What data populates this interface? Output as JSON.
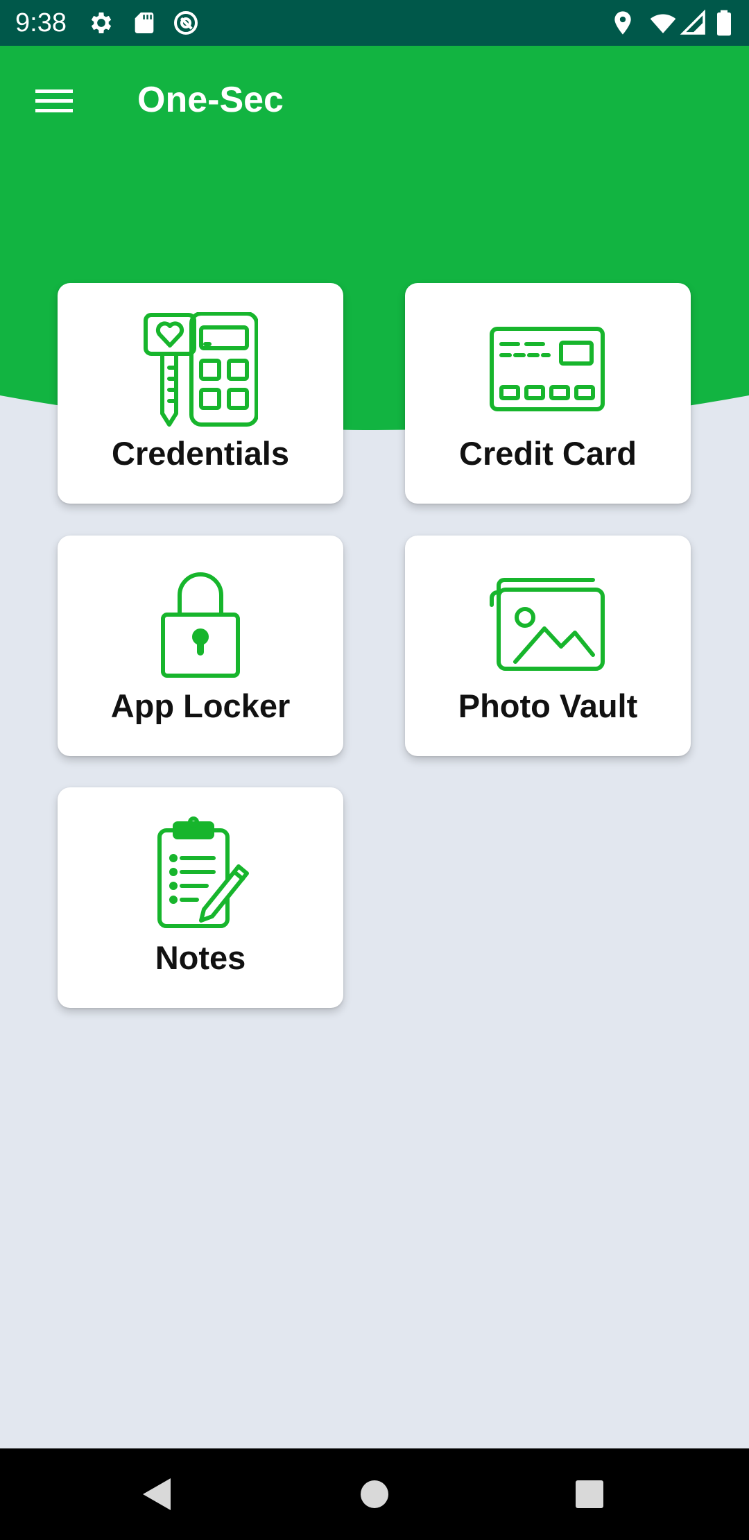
{
  "status_bar": {
    "time": "9:38",
    "left_icons": [
      "gear-icon",
      "sd-card-icon",
      "at-sign-icon"
    ],
    "right_icons": [
      "location-pin-icon",
      "wifi-icon",
      "cell-signal-icon",
      "battery-icon"
    ]
  },
  "app_bar": {
    "title": "One-Sec",
    "menu_icon": "hamburger-menu-icon"
  },
  "tiles": [
    {
      "label": "Credentials",
      "icon": "key-keypad-icon"
    },
    {
      "label": "Credit Card",
      "icon": "credit-card-icon"
    },
    {
      "label": "App Locker",
      "icon": "padlock-icon"
    },
    {
      "label": "Photo Vault",
      "icon": "photo-gallery-icon"
    },
    {
      "label": "Notes",
      "icon": "clipboard-notes-icon"
    }
  ],
  "nav_bar": {
    "buttons": [
      "back-triangle-icon",
      "home-circle-icon",
      "recents-square-icon"
    ]
  },
  "colors": {
    "status_bar": "#00584a",
    "brand_green": "#12b441",
    "icon_green": "#17b52c",
    "background": "#e2e7ef",
    "tile": "#ffffff",
    "nav_bar": "#000000"
  }
}
